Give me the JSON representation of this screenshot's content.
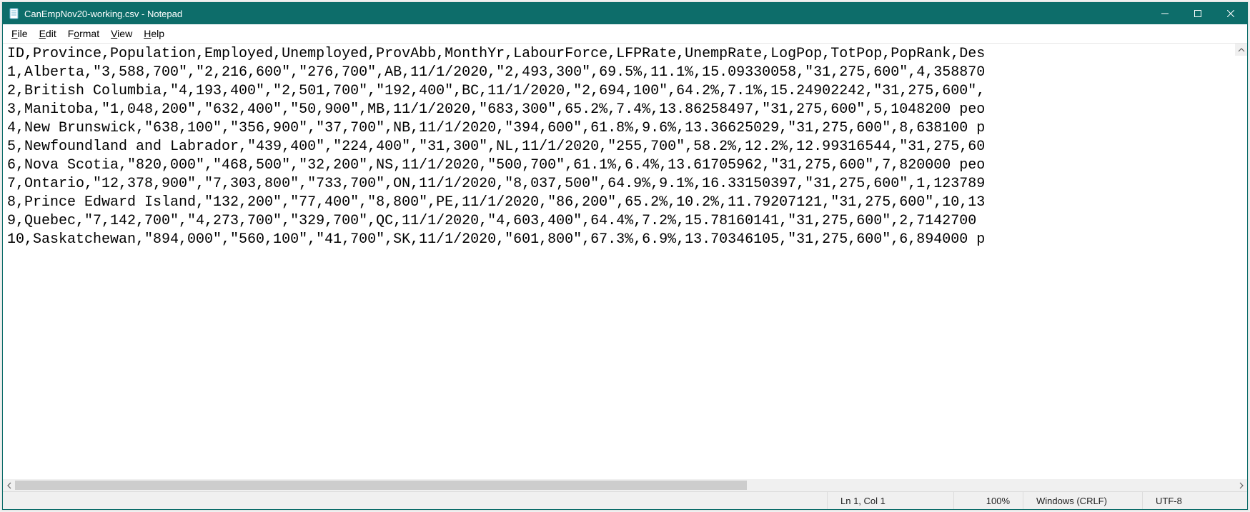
{
  "window": {
    "title": "CanEmpNov20-working.csv - Notepad"
  },
  "menus": {
    "file": "File",
    "edit": "Edit",
    "format": "Format",
    "view": "View",
    "help": "Help"
  },
  "content_lines": [
    "ID,Province,Population,Employed,Unemployed,ProvAbb,MonthYr,LabourForce,LFPRate,UnempRate,LogPop,TotPop,PopRank,Des",
    "1,Alberta,\"3,588,700\",\"2,216,600\",\"276,700\",AB,11/1/2020,\"2,493,300\",69.5%,11.1%,15.09330058,\"31,275,600\",4,358870",
    "2,British Columbia,\"4,193,400\",\"2,501,700\",\"192,400\",BC,11/1/2020,\"2,694,100\",64.2%,7.1%,15.24902242,\"31,275,600\",",
    "3,Manitoba,\"1,048,200\",\"632,400\",\"50,900\",MB,11/1/2020,\"683,300\",65.2%,7.4%,13.86258497,\"31,275,600\",5,1048200 peo",
    "4,New Brunswick,\"638,100\",\"356,900\",\"37,700\",NB,11/1/2020,\"394,600\",61.8%,9.6%,13.36625029,\"31,275,600\",8,638100 p",
    "5,Newfoundland and Labrador,\"439,400\",\"224,400\",\"31,300\",NL,11/1/2020,\"255,700\",58.2%,12.2%,12.99316544,\"31,275,60",
    "6,Nova Scotia,\"820,000\",\"468,500\",\"32,200\",NS,11/1/2020,\"500,700\",61.1%,6.4%,13.61705962,\"31,275,600\",7,820000 peo",
    "7,Ontario,\"12,378,900\",\"7,303,800\",\"733,700\",ON,11/1/2020,\"8,037,500\",64.9%,9.1%,16.33150397,\"31,275,600\",1,123789",
    "8,Prince Edward Island,\"132,200\",\"77,400\",\"8,800\",PE,11/1/2020,\"86,200\",65.2%,10.2%,11.79207121,\"31,275,600\",10,13",
    "9,Quebec,\"7,142,700\",\"4,273,700\",\"329,700\",QC,11/1/2020,\"4,603,400\",64.4%,7.2%,15.78160141,\"31,275,600\",2,7142700 ",
    "10,Saskatchewan,\"894,000\",\"560,100\",\"41,700\",SK,11/1/2020,\"601,800\",67.3%,6.9%,13.70346105,\"31,275,600\",6,894000 p"
  ],
  "status": {
    "position": "Ln 1, Col 1",
    "zoom": "100%",
    "line_endings": "Windows (CRLF)",
    "encoding": "UTF-8"
  }
}
